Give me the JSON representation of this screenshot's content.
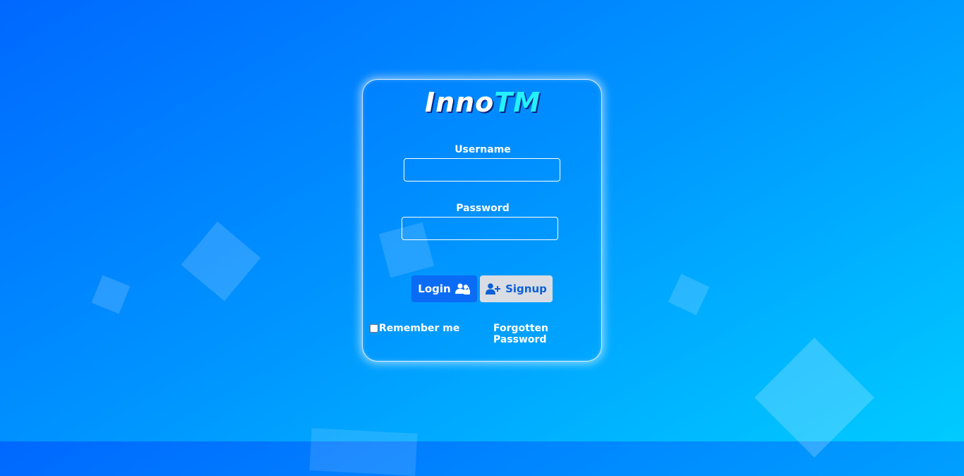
{
  "brand": {
    "part1": "Inno",
    "part2": "TM",
    "part1_color": "#ffffff",
    "part2_color": "#26f0ff"
  },
  "form": {
    "username_label": "Username",
    "username_value": "",
    "password_label": "Password",
    "password_value": "",
    "login_label": "Login",
    "login_icon": "users-icon",
    "signup_label": "Signup",
    "signup_icon": "user-plus-icon",
    "remember_label": "Remember me",
    "remember_checked": false,
    "forgot_label": "Forgotten Password"
  },
  "colors": {
    "background_start": "#0068ff",
    "background_end": "#00cbff",
    "login_button": "#0a6cf5",
    "signup_button": "#d9dde3",
    "signup_text": "#0b5fd8"
  }
}
